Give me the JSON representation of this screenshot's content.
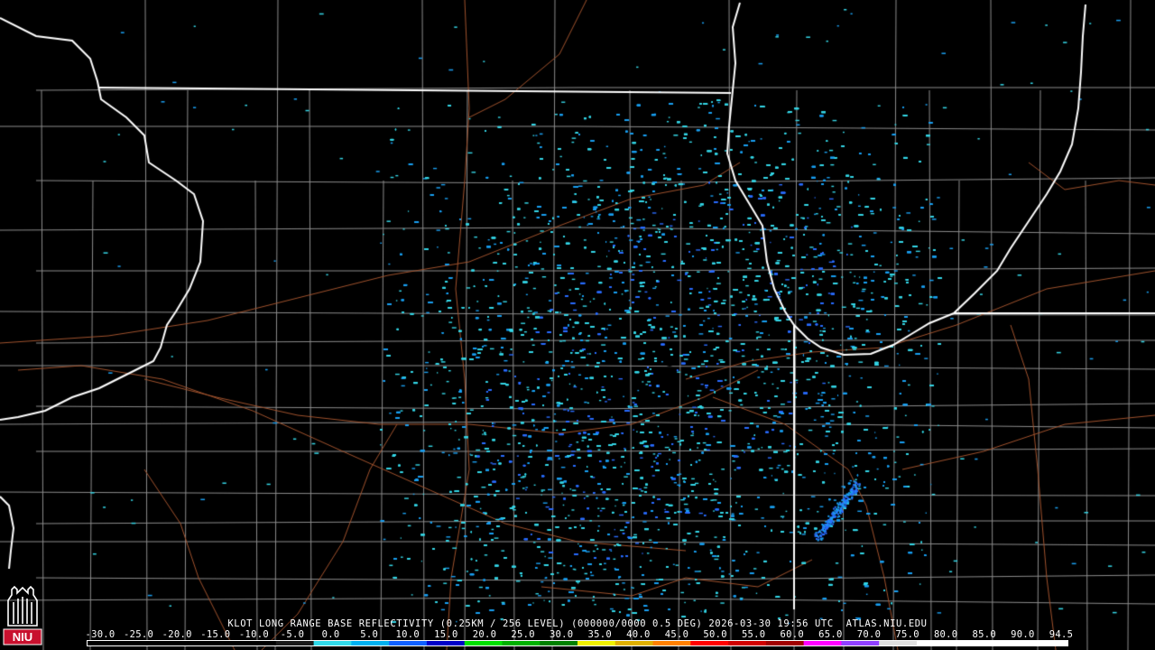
{
  "product": {
    "title": "KLOT LONG RANGE BASE REFLECTIVITY (0.25KM / 256 LEVEL) (000000/0000 0.5 DEG) 2026-03-30 19:56 UTC  ATLAS.NIU.EDU",
    "radar_site": "KLOT"
  },
  "color_scale": {
    "labels": [
      "-30.0",
      "-25.0",
      "-20.0",
      "-15.0",
      "-10.0",
      "-5.0",
      "0.0",
      "5.0",
      "10.0",
      "15.0",
      "20.0",
      "25.0",
      "30.0",
      "35.0",
      "40.0",
      "45.0",
      "50.0",
      "55.0",
      "60.0",
      "65.0",
      "70.0",
      "75.0",
      "80.0",
      "85.0",
      "90.0",
      "94.5"
    ],
    "colors": [
      "#000000",
      "#000000",
      "#000000",
      "#000000",
      "#000000",
      "#1a1a1a",
      "#30d8e8",
      "#00b0f0",
      "#1060ff",
      "#0000c8",
      "#00e000",
      "#00b000",
      "#008000",
      "#f0f000",
      "#e0b000",
      "#ff8000",
      "#ff0000",
      "#d00000",
      "#a00000",
      "#ff00ff",
      "#9040ff",
      "#e0e0e0",
      "#ffffff",
      "#ffffff",
      "#ffffff",
      "#ffffff"
    ]
  },
  "map_colors": {
    "background": "#000000",
    "state_lines": "#ffffff",
    "county_lines": "#8c8c8c",
    "roads": "#a0522d",
    "echo_light": "#35d6e6",
    "echo_mid": "#1a9ff0",
    "echo_dark": "#2a6cff"
  },
  "logo": {
    "text": "NIU",
    "color": "#c8102e"
  }
}
